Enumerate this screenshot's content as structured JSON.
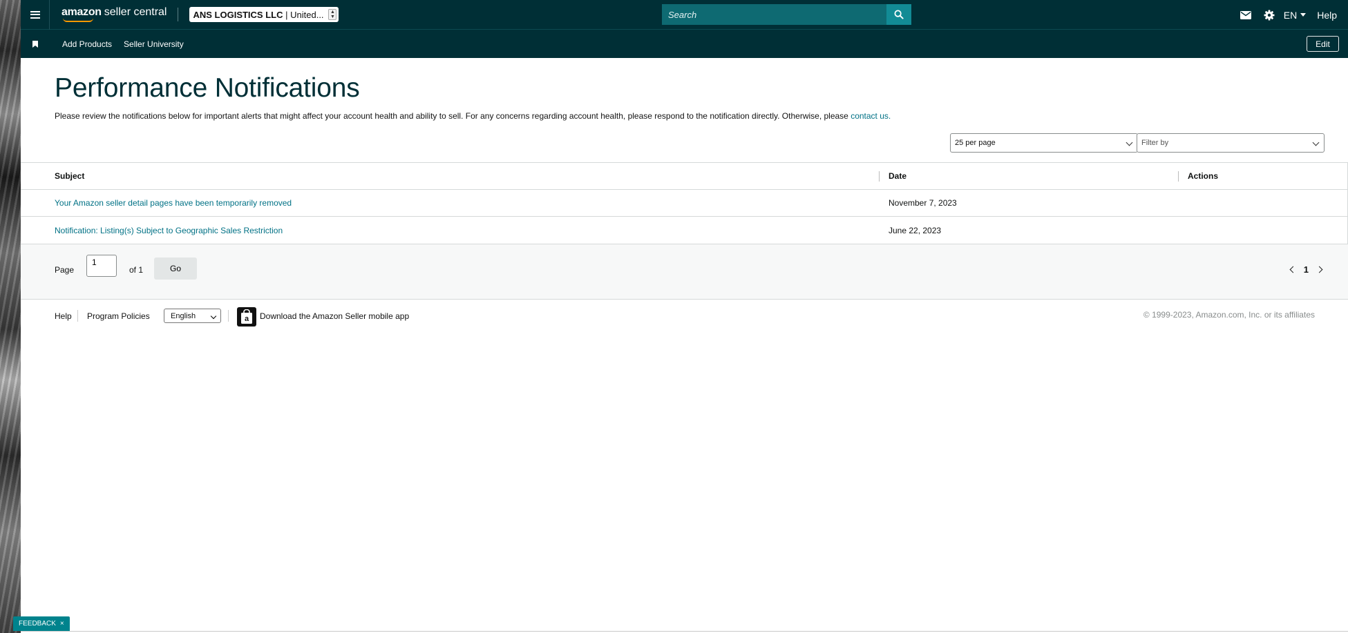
{
  "header": {
    "brand_amazon": "amazon",
    "brand_product": "seller central",
    "account": "ANS LOGISTICS LLC",
    "account_separator": "|",
    "account_region": "United...",
    "search_placeholder": "Search",
    "language": "EN",
    "help": "Help",
    "icons": [
      "menu-icon",
      "search-icon",
      "mail-icon",
      "gear-icon",
      "caret-down-icon"
    ]
  },
  "navbar": {
    "links": [
      "Add Products",
      "Seller University"
    ],
    "edit_label": "Edit"
  },
  "page": {
    "title": "Performance Notifications",
    "intro": "Please review the notifications below for important alerts that might affect your account health and ability to sell. For any concerns regarding account health, please respond to the notification directly. Otherwise, please",
    "contact_link": "contact us."
  },
  "controls": {
    "per_page": "25 per page",
    "filter_placeholder": "Filter by"
  },
  "table": {
    "columns": [
      "Subject",
      "Date",
      "Actions"
    ],
    "rows": [
      {
        "subject": "Your Amazon seller detail pages have been temporarily removed",
        "date": "November 7, 2023",
        "actions": ""
      },
      {
        "subject": "Notification: Listing(s) Subject to Geographic Sales Restriction",
        "date": "June 22, 2023",
        "actions": ""
      }
    ]
  },
  "pagination": {
    "page_label": "Page",
    "page_value": "1",
    "of_label": "of 1",
    "go_label": "Go",
    "current_page": "1"
  },
  "footer": {
    "help": "Help",
    "policies": "Program Policies",
    "language": "English",
    "app_link": "Download the Amazon Seller mobile app",
    "copyright": "© 1999-2023, Amazon.com, Inc. or its affiliates"
  },
  "feedback": {
    "label": "FEEDBACK",
    "close": "×"
  },
  "colors": {
    "header_bg": "#002f36",
    "link": "#007185",
    "search_bg": "#0e6a72",
    "search_btn": "#128b95",
    "feedback_bg": "#00838d",
    "brand_smile": "#ff9900"
  }
}
